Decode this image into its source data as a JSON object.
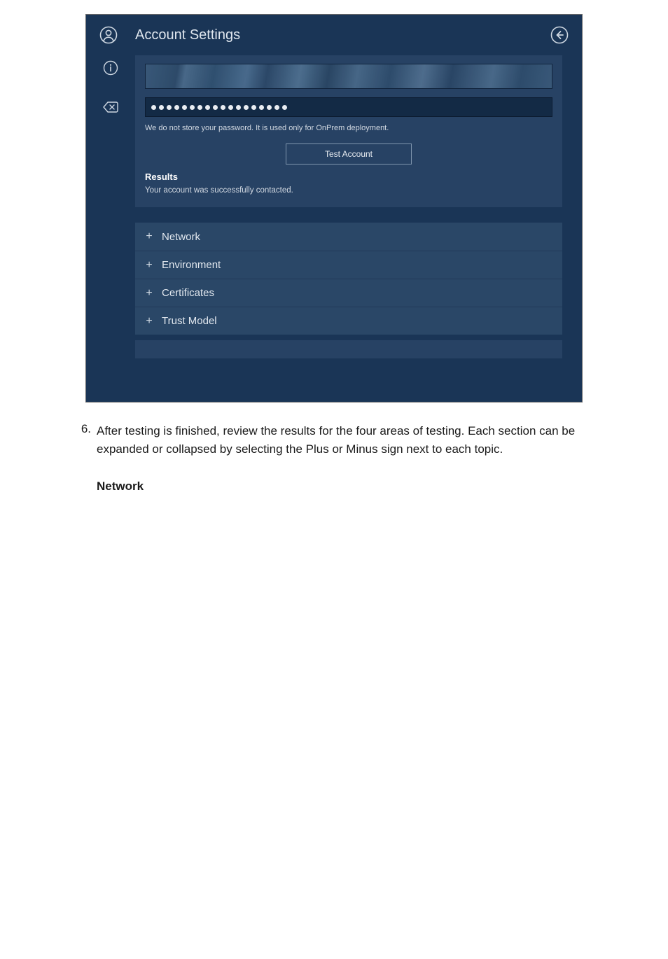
{
  "screenshot": {
    "title": "Account Settings",
    "icons": {
      "user": "user-circle",
      "back": "back-circle",
      "info": "info-circle",
      "erase": "erase"
    },
    "username_field": {
      "redacted": true
    },
    "password_field": {
      "dot_count": 18
    },
    "password_hint": "We do not store your password. It is used only for OnPrem deployment.",
    "test_button_label": "Test Account",
    "results_heading": "Results",
    "results_text": "Your account was successfully contacted.",
    "accordion": [
      {
        "expander": "+",
        "label": "Network"
      },
      {
        "expander": "+",
        "label": "Environment"
      },
      {
        "expander": "+",
        "label": "Certificates"
      },
      {
        "expander": "+",
        "label": "Trust Model"
      }
    ]
  },
  "doc": {
    "step_number": "6.",
    "step_text": "After testing is finished, review the results for the four areas of testing. Each section can be expanded or collapsed by selecting the Plus or Minus sign next to each topic.",
    "subhead": "Network"
  }
}
